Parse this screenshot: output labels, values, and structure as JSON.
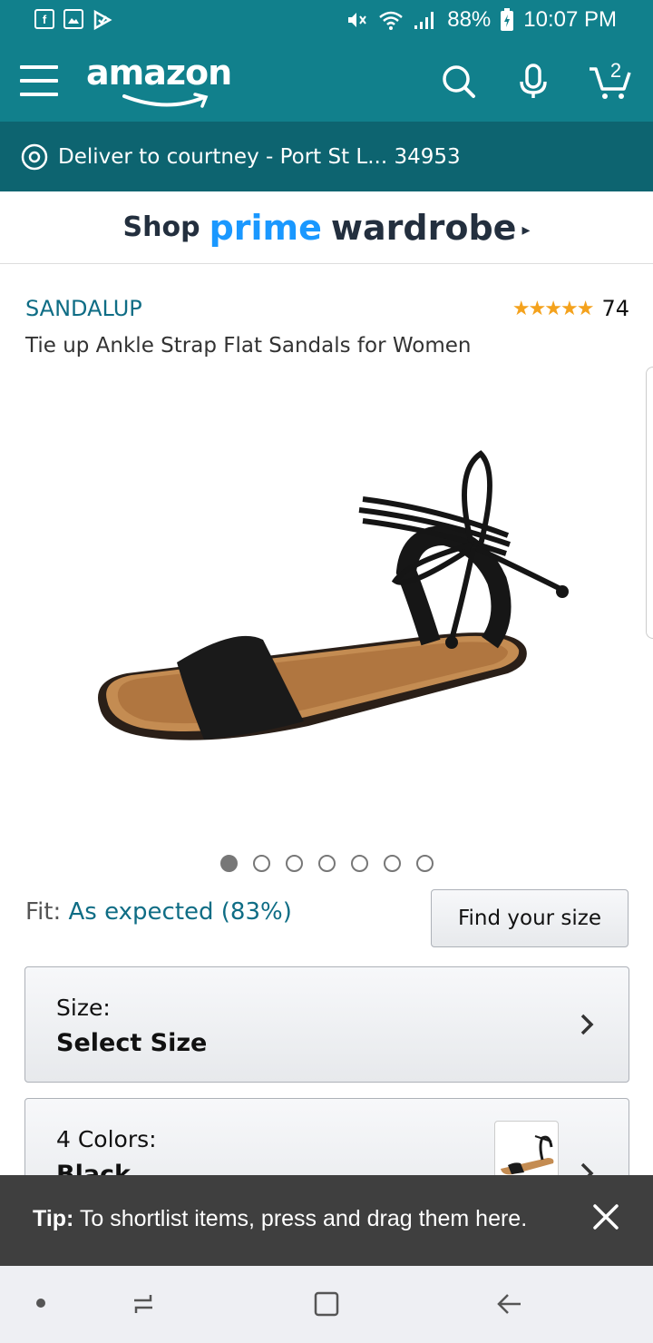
{
  "status_bar": {
    "battery": "88%",
    "time": "10:07 PM",
    "left_icons": [
      "facebook-icon",
      "gallery-icon",
      "check-icon"
    ]
  },
  "header": {
    "logo": "amazon",
    "cart_count": "2"
  },
  "deliver": {
    "text": "Deliver to courtney - Port St L... 34953"
  },
  "banner": {
    "shop": "Shop",
    "prime": "prime",
    "wardrobe": "wardrobe",
    "arrow": "▸"
  },
  "product": {
    "brand": "SANDALUP",
    "title": "Tie up Ankle Strap Flat Sandals for Women",
    "stars": "★★★★★",
    "rating": 4.5,
    "review_count": "74",
    "image_count": 7,
    "active_image": 1
  },
  "fit": {
    "label": "Fit:",
    "value": "As expected (83%)",
    "button": "Find your size"
  },
  "size": {
    "label": "Size:",
    "value": "Select Size"
  },
  "colors": {
    "label": "4 Colors:",
    "value": "Black"
  },
  "tip": {
    "bold": "Tip:",
    "text": " To shortlist items, press and drag them here."
  },
  "colors_theme": {
    "header": "#11808c",
    "deliver": "#0d6470",
    "link": "#0f6d85",
    "prime": "#1a98ff",
    "star": "#f4a21d"
  }
}
